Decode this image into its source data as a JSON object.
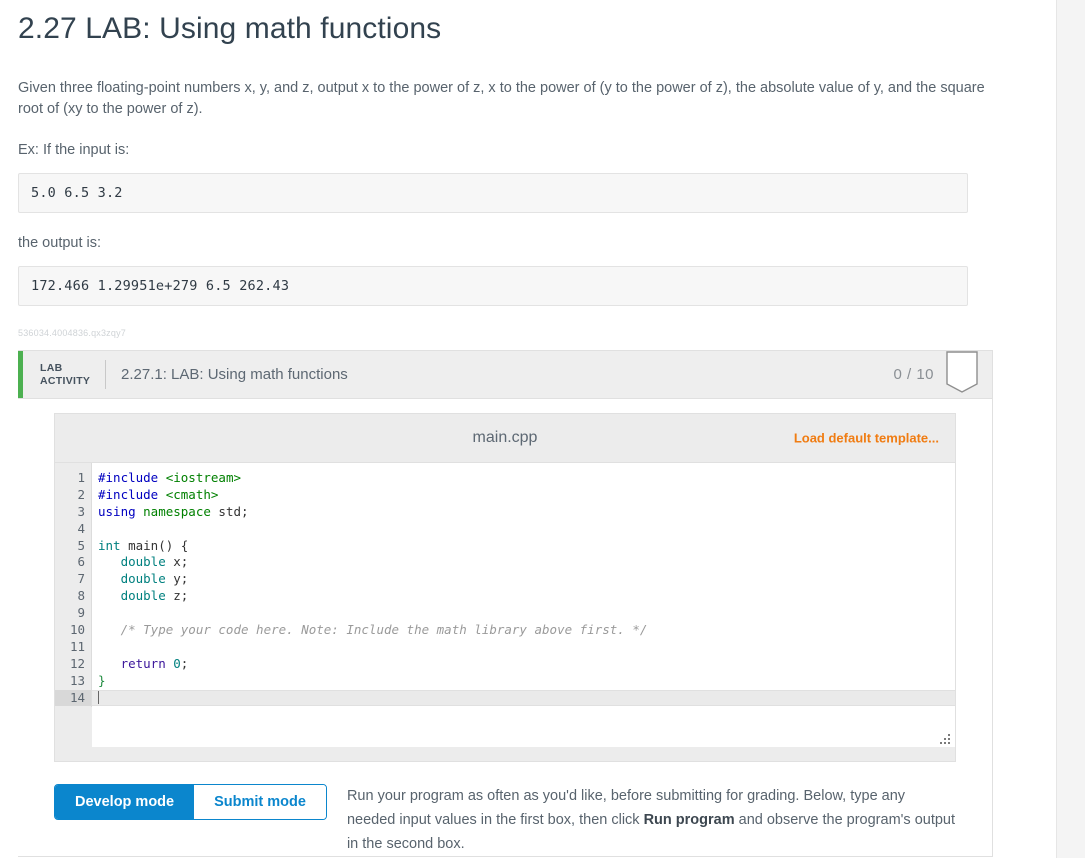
{
  "page": {
    "title": "2.27 LAB: Using math functions",
    "description_line_1": "Given three floating-point numbers x, y, and z, output x to the power of z, x to the power of (y to the power of z), the absolute value of y, and the square root of (xy to the power of z).",
    "example_intro": "Ex: If the input is:",
    "example_input": "5.0 6.5 3.2",
    "output_intro": "the output is:",
    "example_output": "172.466 1.29951e+279 6.5 262.43",
    "activity_id": "536034.4004836.qx3zqy7"
  },
  "lab_activity": {
    "badge_line_1": "LAB",
    "badge_line_2": "ACTIVITY",
    "title": "2.27.1: LAB: Using math functions",
    "score": "0 / 10",
    "accent_color": "#4cb050"
  },
  "editor": {
    "file_name": "main.cpp",
    "load_template_label": "Load default template...",
    "accent_color": "#f07c12",
    "line_numbers": [
      "1",
      "2",
      "3",
      "4",
      "5",
      "6",
      "7",
      "8",
      "9",
      "10",
      "11",
      "12",
      "13",
      "14"
    ],
    "active_line": "14",
    "code_lines": [
      {
        "n": "1",
        "tokens": [
          {
            "t": "#include ",
            "c": "k-pre"
          },
          {
            "t": "<iostream>",
            "c": "k-inc"
          }
        ]
      },
      {
        "n": "2",
        "tokens": [
          {
            "t": "#include ",
            "c": "k-pre"
          },
          {
            "t": "<cmath>",
            "c": "k-inc"
          }
        ]
      },
      {
        "n": "3",
        "tokens": [
          {
            "t": "using ",
            "c": "k-use"
          },
          {
            "t": "namespace ",
            "c": "k-ns"
          },
          {
            "t": "std;",
            "c": "k-plain"
          }
        ]
      },
      {
        "n": "4",
        "tokens": []
      },
      {
        "n": "5",
        "tokens": [
          {
            "t": "int ",
            "c": "k-type"
          },
          {
            "t": "main() {",
            "c": "k-plain"
          }
        ]
      },
      {
        "n": "6",
        "tokens": [
          {
            "t": "   double ",
            "c": "k-type"
          },
          {
            "t": "x;",
            "c": "k-plain"
          }
        ]
      },
      {
        "n": "7",
        "tokens": [
          {
            "t": "   double ",
            "c": "k-type"
          },
          {
            "t": "y;",
            "c": "k-plain"
          }
        ]
      },
      {
        "n": "8",
        "tokens": [
          {
            "t": "   double ",
            "c": "k-type"
          },
          {
            "t": "z;",
            "c": "k-plain"
          }
        ]
      },
      {
        "n": "9",
        "tokens": []
      },
      {
        "n": "10",
        "tokens": [
          {
            "t": "   /* Type your code here. Note: Include the math library above first. */",
            "c": "k-cmt"
          }
        ]
      },
      {
        "n": "11",
        "tokens": []
      },
      {
        "n": "12",
        "tokens": [
          {
            "t": "   return ",
            "c": "k-ret"
          },
          {
            "t": "0",
            "c": "k-num"
          },
          {
            "t": ";",
            "c": "k-plain"
          }
        ]
      },
      {
        "n": "13",
        "tokens": [
          {
            "t": "}",
            "c": "k-brace"
          }
        ]
      },
      {
        "n": "14",
        "tokens": []
      }
    ]
  },
  "mode": {
    "develop_label": "Develop mode",
    "submit_label": "Submit mode",
    "active": "Develop mode",
    "accent_color": "#0b86cd",
    "description_part_1": "Run your program as often as you'd like, before submitting for grading. Below, type any needed input values in the first box, then click ",
    "description_bold": "Run program",
    "description_part_2": " and observe the program's output in the second box."
  }
}
